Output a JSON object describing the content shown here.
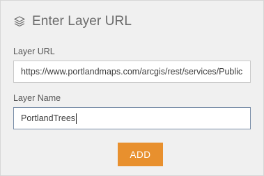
{
  "dialog": {
    "title": "Enter Layer URL",
    "icon": "layers-icon"
  },
  "layer_url": {
    "label": "Layer URL",
    "value": "https://www.portlandmaps.com/arcgis/rest/services/Public"
  },
  "layer_name": {
    "label": "Layer Name",
    "value": "PortlandTrees"
  },
  "add_button": {
    "label": "ADD",
    "color": "#e8902e"
  }
}
